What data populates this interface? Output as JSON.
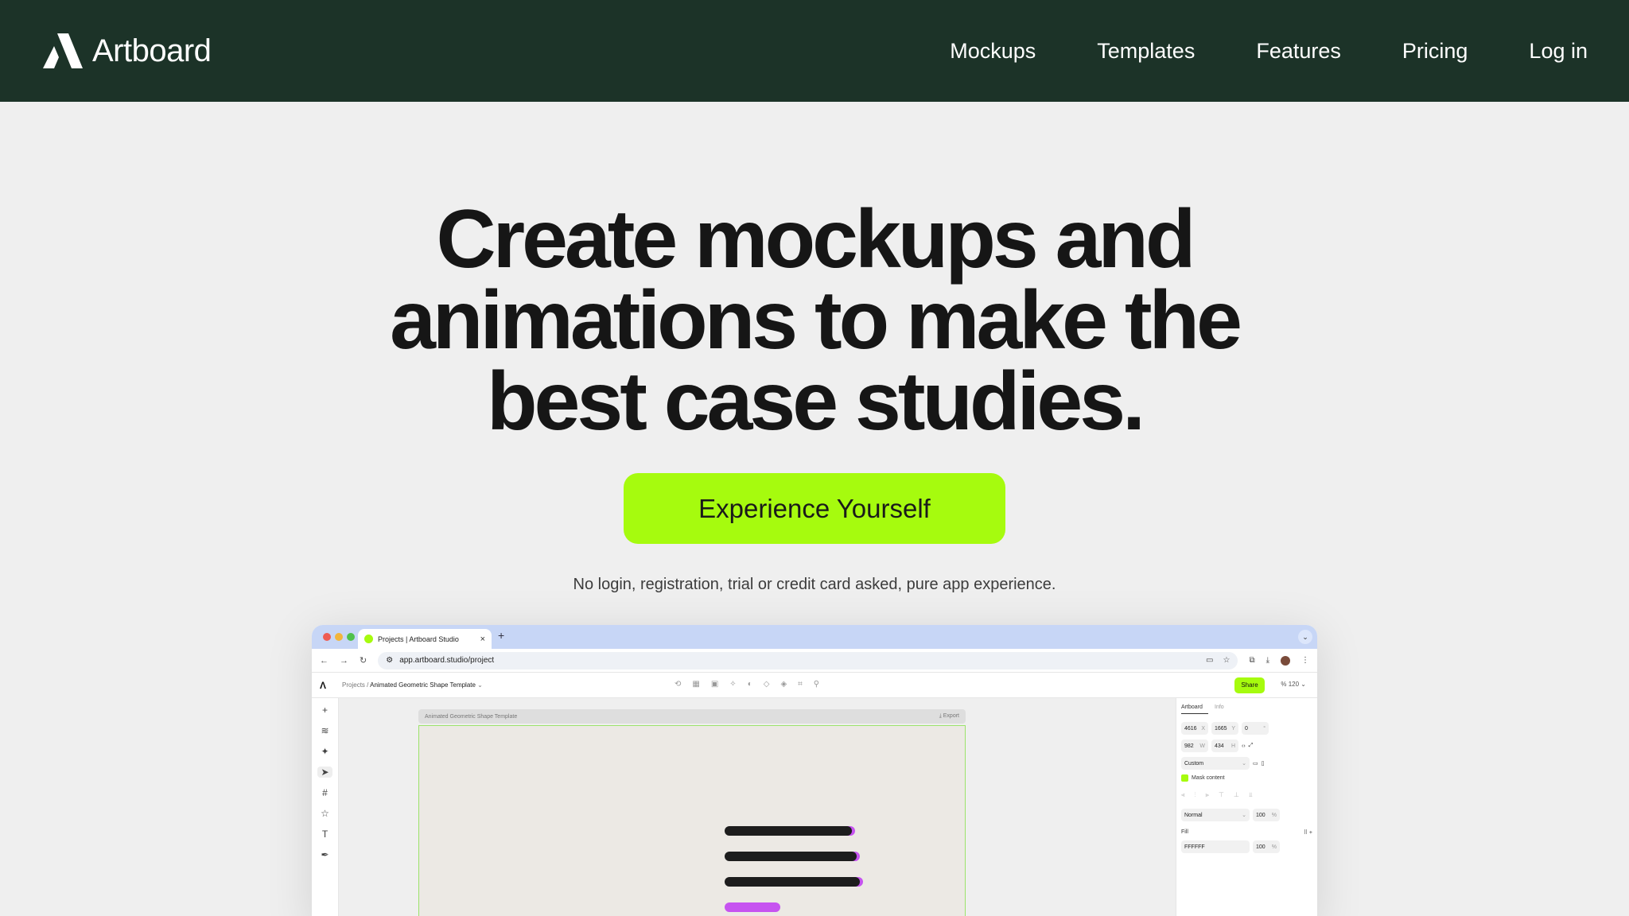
{
  "nav": {
    "brand": "Artboard",
    "links": [
      "Mockups",
      "Templates",
      "Features",
      "Pricing",
      "Log in"
    ]
  },
  "hero": {
    "title_lines": [
      "Create mockups and",
      "animations to make the",
      "best case studies."
    ],
    "cta": "Experience Yourself",
    "note": "No login, registration, trial or credit card asked, pure app experience."
  },
  "preview": {
    "tab_title": "Projects | Artboard Studio",
    "url": "app.artboard.studio/project",
    "breadcrumb_root": "Projects /",
    "breadcrumb_current": "Animated Geometric Shape Template",
    "share_label": "Share",
    "zoom_value": "120",
    "frame_title": "Animated Geometric Shape Template",
    "export_label": "Export",
    "panel": {
      "tabs": [
        "Artboard",
        "Info"
      ],
      "x_value": "4616",
      "x_label": "X",
      "y_value": "1665",
      "y_label": "Y",
      "r_value": "0",
      "r_label": "°",
      "w_value": "982",
      "w_label": "W",
      "h_value": "434",
      "h_label": "H",
      "preset": "Custom",
      "mask_label": "Mask content",
      "blend": "Normal",
      "opacity": "100",
      "opacity_unit": "%",
      "fill_label": "Fill",
      "fill_hex": "FFFFFF",
      "fill_opacity": "100"
    },
    "colors": {
      "accent": "#a6fb0e",
      "nav_bg": "#1c3328",
      "tabbar": "#c7d6f6"
    }
  }
}
